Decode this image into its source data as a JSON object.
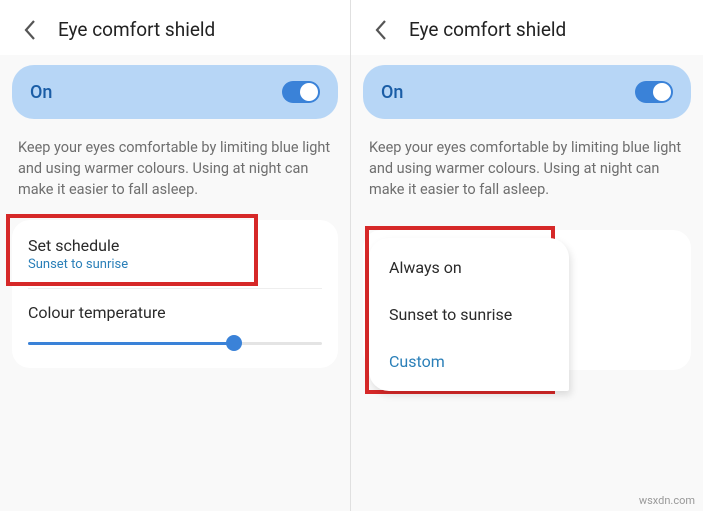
{
  "left": {
    "title": "Eye comfort shield",
    "on_label": "On",
    "desc": "Keep your eyes comfortable by limiting blue light and using warmer colours. Using at night can make it easier to fall asleep.",
    "schedule_title": "Set schedule",
    "schedule_value": "Sunset to sunrise",
    "temp_label": "Colour temperature",
    "slider_percent": 70
  },
  "right": {
    "title": "Eye comfort shield",
    "on_label": "On",
    "desc": "Keep your eyes comfortable by limiting blue light and using warmer colours. Using at night can make it easier to fall asleep.",
    "options": [
      "Always on",
      "Sunset to sunrise",
      "Custom"
    ]
  },
  "watermark": "wsxdn.com"
}
